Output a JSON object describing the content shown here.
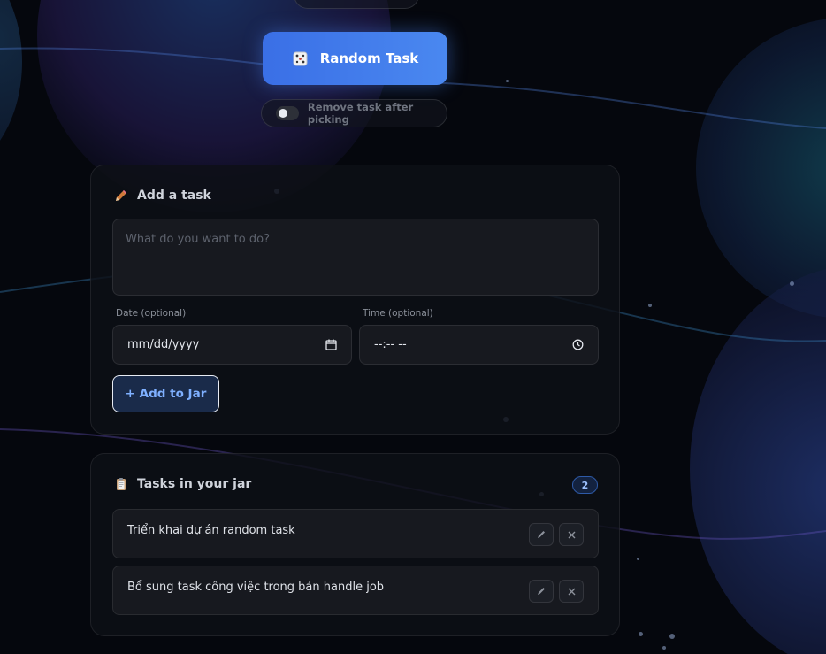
{
  "random_button": {
    "label": "Random Task",
    "icon": "dice-icon"
  },
  "toggle": {
    "label": "Remove task after picking",
    "checked": false
  },
  "add_card": {
    "title": "Add a task",
    "icon": "pencil-icon",
    "task_placeholder": "What do you want to do?",
    "date_label": "Date (optional)",
    "date_value": "mm/dd/yyyy",
    "time_label": "Time (optional)",
    "time_value": "--:-- --",
    "add_button": "+ Add to Jar"
  },
  "list_card": {
    "title": "Tasks in your jar",
    "icon": "clipboard-icon",
    "count": "2",
    "tasks": [
      {
        "text": "Triển khai dự án random task"
      },
      {
        "text": "Bổ sung task công việc trong bản handle job"
      }
    ]
  },
  "colors": {
    "accent": "#4a88f0",
    "background": "#05070d",
    "card": "#0e1016"
  }
}
